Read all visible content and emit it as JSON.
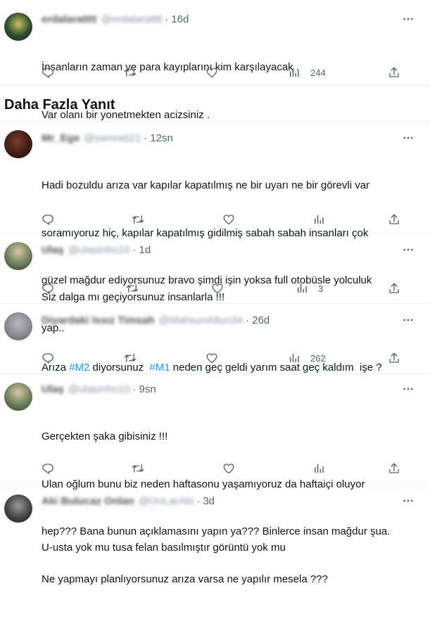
{
  "section_title": "Daha Fazla Yanıt",
  "colors": {
    "accent": "#1d9bf0",
    "muted": "#536471",
    "divider": "#eff3f4"
  },
  "tweets": [
    {
      "name": "erdalaratttt",
      "handle": "@erdalaratttt",
      "time": "16d",
      "lines": [
        "İnsanların zaman ve para kayıplarını kim karşılayacak .",
        "Var olanı bir yonetmekten acizsiniz ."
      ],
      "views": "244"
    },
    {
      "name": "Mr_Ege",
      "handle": "@samnet21",
      "time": "12sn",
      "lines": [
        "Hadi bozuldu arıza var kapılar kapatılmış ne bir uyarı ne bir görevli var",
        "soramıyoruz hiç, kapılar kapatılmış gidilmiş sabah sabah insanları çok",
        "güzel mağdur ediyorsunuz bravo şimdi işin yoksa full otobüsle yolculuk",
        "yap.."
      ],
      "views": ""
    },
    {
      "name": "Ulaş",
      "handle": "@ulasinho10",
      "time": "1d",
      "lines": [
        "Siz dalga mı geçiyorsunuz insanlarla !!!"
      ],
      "views": "3"
    },
    {
      "name": "Diyardaki Issız Timsah",
      "handle": "@MahsunAltun34",
      "time": "26d",
      "line_parts": [
        {
          "text": "Arıza ",
          "tag": false
        },
        {
          "text": "#M2",
          "tag": true
        },
        {
          "text": " diyorsunuz  ",
          "tag": false
        },
        {
          "text": "#M1",
          "tag": true
        },
        {
          "text": " neden geç geldi yarım saat geç kaldım  işe ?",
          "tag": false
        }
      ],
      "views": "262"
    },
    {
      "name": "Ulaş",
      "handle": "@ulasinho10",
      "time": "9sn",
      "lines": [
        "Gerçekten şaka gibisiniz !!!",
        "Ulan oğlum bunu biz neden haftasonu yaşamıyoruz da haftaiçi oluyor",
        "hep??? Bana bunun açıklamasını yapın ya??? Binlerce insan mağdur şua.",
        "Ne yapmayı planlıyorsunuz arıza varsa ne yapılır mesela ???"
      ],
      "views": ""
    },
    {
      "name": "Aki Bulucaz Onlan",
      "handle": "@OnLarAbi",
      "time": "3d",
      "lines": [
        "U-usta yok mu tusa felan basılmıştır görüntü yok mu"
      ],
      "views": ""
    }
  ]
}
